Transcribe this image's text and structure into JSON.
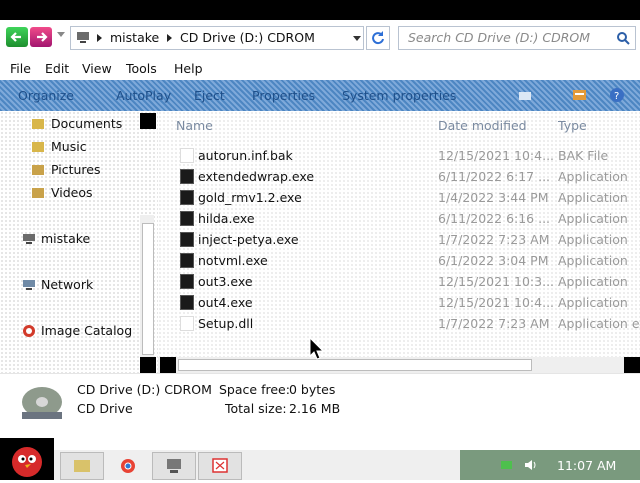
{
  "address": {
    "crumbs": [
      "mistake",
      "CD Drive (D:) CDROM"
    ],
    "search_placeholder": "Search CD Drive (D:) CDROM"
  },
  "menu": [
    "File",
    "Edit",
    "View",
    "Tools",
    "Help"
  ],
  "toolbar": [
    "Organize",
    "AutoPlay",
    "Eject",
    "Properties",
    "System properties"
  ],
  "nav": {
    "items": [
      "Documents",
      "Music",
      "Pictures",
      "Videos",
      "mistake",
      "Network",
      "Image Catalog"
    ]
  },
  "columns": {
    "name": "Name",
    "date": "Date modified",
    "type": "Type"
  },
  "files": [
    {
      "name": "autorun.inf.bak",
      "date": "12/15/2021 10:4...",
      "type": "BAK File",
      "icon": "text-file-icon"
    },
    {
      "name": "extendedwrap.exe",
      "date": "6/11/2022 6:17 ...",
      "type": "Application",
      "icon": "exe-icon"
    },
    {
      "name": "gold_rmv1.2.exe",
      "date": "1/4/2022 3:44 PM",
      "type": "Application",
      "icon": "exe-icon"
    },
    {
      "name": "hilda.exe",
      "date": "6/11/2022 6:16 ...",
      "type": "Application",
      "icon": "exe-icon"
    },
    {
      "name": "inject-petya.exe",
      "date": "1/7/2022 7:23 AM",
      "type": "Application",
      "icon": "exe-icon"
    },
    {
      "name": "notvml.exe",
      "date": "6/1/2022 3:04 PM",
      "type": "Application",
      "icon": "exe-icon"
    },
    {
      "name": "out3.exe",
      "date": "12/15/2021 10:3...",
      "type": "Application",
      "icon": "exe-icon"
    },
    {
      "name": "out4.exe",
      "date": "12/15/2021 10:4...",
      "type": "Application",
      "icon": "exe-icon"
    },
    {
      "name": "Setup.dll",
      "date": "1/7/2022 7:23 AM",
      "type": "Application ex",
      "icon": "text-file-icon"
    }
  ],
  "details": {
    "drive_name": "CD Drive (D:) CDROM",
    "drive_type": "CD Drive",
    "space_free_label": "Space free:",
    "space_free": "0 bytes",
    "total_size_label": "Total size:",
    "total_size": "2.16 MB"
  },
  "taskbar": {
    "clock": "11:07 AM"
  }
}
